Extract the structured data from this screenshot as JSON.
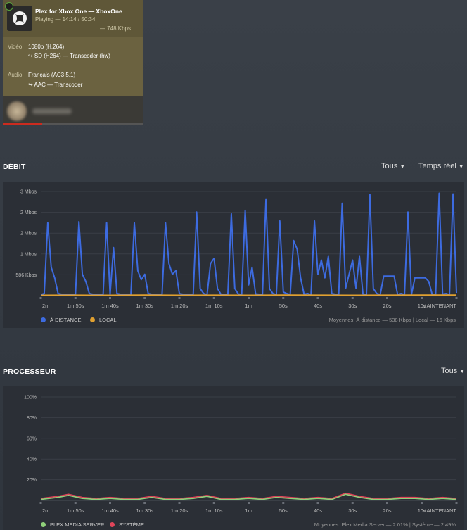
{
  "now_playing": {
    "title": "Plex for Xbox One  —  XboxOne",
    "status": "Playing — 14:14 / 50:34",
    "bitrate": "— 748 Kbps",
    "progress": 0.28,
    "video_label": "Vidéo",
    "video_value": "1080p (H.264)",
    "video_transcode": "↪  SD (H264) — Transcoder (hw)",
    "audio_label": "Audio",
    "audio_value": "Français (AC3 5.1)",
    "audio_transcode": "↪  AAC — Transcoder",
    "icons": {
      "thumb": "xbox-logo-icon",
      "lock": "lock-icon"
    }
  },
  "bandwidth": {
    "title": "DÉBIT",
    "filter_label": "Tous",
    "range_label": "Temps réel",
    "legend_remote": "À DISTANCE",
    "legend_local": "LOCAL",
    "averages": "Moyennes: À distance — 538 Kbps | Local — 16 Kbps",
    "colors": {
      "remote": "#3d6be0",
      "local": "#e0a030"
    }
  },
  "cpu": {
    "title": "PROCESSEUR",
    "filter_label": "Tous",
    "legend_pms": "PLEX MEDIA SERVER",
    "legend_system": "SYSTÈME",
    "averages": "Moyennes: Plex Media Server — 2.01% | Système — 2.49%",
    "colors": {
      "pms": "#8fd07a",
      "system": "#e0455a"
    }
  },
  "chart_data": [
    {
      "type": "line",
      "title": "DÉBIT",
      "y_ticks": [
        "586 Kbps",
        "1 Mbps",
        "2 Mbps",
        "2 Mbps",
        "3 Mbps"
      ],
      "y_tick_values": [
        586,
        1172,
        1758,
        2344,
        2930
      ],
      "ylim": [
        0,
        2930
      ],
      "x_ticks": [
        "2m",
        "1m 50s",
        "1m 40s",
        "1m 30s",
        "1m 20s",
        "1m 10s",
        "1m",
        "50s",
        "40s",
        "30s",
        "20s",
        "10s",
        "MAINTENANT"
      ],
      "x_range_seconds": [
        -120,
        0
      ],
      "series": [
        {
          "name": "À DISTANCE",
          "t": [
            -120,
            -119,
            -118,
            -117,
            -116,
            -115,
            -114,
            -113,
            -112,
            -111,
            -110,
            -109,
            -108,
            -107,
            -106,
            -105,
            -104,
            -103,
            -102,
            -101,
            -100,
            -99,
            -98,
            -97,
            -96,
            -95,
            -94,
            -93,
            -92,
            -91,
            -90,
            -89,
            -88,
            -87,
            -86,
            -85,
            -84,
            -83,
            -82,
            -81,
            -80,
            -79,
            -78,
            -77,
            -76,
            -75,
            -74,
            -73,
            -72,
            -71,
            -70,
            -69,
            -68,
            -67,
            -66,
            -65,
            -64,
            -63,
            -62,
            -61,
            -60,
            -59,
            -58,
            -57,
            -56,
            -55,
            -54,
            -53,
            -52,
            -51,
            -50,
            -49,
            -48,
            -47,
            -46,
            -45,
            -44,
            -43,
            -42,
            -41,
            -40,
            -39,
            -38,
            -37,
            -36,
            -35,
            -34,
            -33,
            -32,
            -31,
            -30,
            -29,
            -28,
            -27,
            -26,
            -25,
            -24,
            -23,
            -22,
            -21,
            -20,
            -19,
            -18,
            -17,
            -16,
            -15,
            -14,
            -13,
            -12,
            -11,
            -10,
            -9,
            -8,
            -7,
            -6,
            -5,
            -4,
            -3,
            -2,
            -1,
            0
          ],
          "values": [
            30,
            60,
            2050,
            800,
            500,
            60,
            40,
            40,
            40,
            40,
            30,
            2080,
            600,
            400,
            60,
            40,
            40,
            40,
            30,
            2050,
            30,
            1350,
            60,
            40,
            40,
            40,
            30,
            2050,
            700,
            450,
            600,
            60,
            40,
            40,
            40,
            30,
            2050,
            900,
            600,
            700,
            60,
            40,
            40,
            40,
            30,
            2350,
            200,
            60,
            30,
            900,
            1050,
            200,
            40,
            40,
            30,
            2300,
            200,
            50,
            30,
            2400,
            300,
            800,
            50,
            40,
            30,
            2700,
            200,
            60,
            30,
            2100,
            100,
            60,
            30,
            1550,
            1300,
            500,
            40,
            60,
            30,
            2100,
            600,
            1000,
            500,
            1100,
            60,
            40,
            30,
            2600,
            200,
            600,
            1000,
            200,
            1100,
            50,
            30,
            2850,
            200,
            60,
            30,
            550,
            550,
            550,
            550,
            30,
            60,
            30,
            2350,
            30,
            500,
            500,
            500,
            500,
            400,
            30,
            30,
            2880,
            40,
            60,
            30,
            2860,
            80,
            1000,
            60,
            1100,
            40,
            1050,
            150,
            520
          ]
        },
        {
          "name": "LOCAL",
          "t": [
            -120,
            -110,
            -100,
            -90,
            -80,
            -70,
            -60,
            -50,
            -40,
            -30,
            -20,
            -10,
            0
          ],
          "values": [
            10,
            12,
            10,
            14,
            10,
            12,
            10,
            14,
            12,
            10,
            12,
            14,
            16
          ]
        }
      ]
    },
    {
      "type": "line",
      "title": "PROCESSEUR",
      "y_ticks": [
        "20%",
        "40%",
        "60%",
        "80%",
        "100%"
      ],
      "y_tick_values": [
        20,
        40,
        60,
        80,
        100
      ],
      "ylim": [
        0,
        100
      ],
      "x_ticks": [
        "2m",
        "1m 50s",
        "1m 40s",
        "1m 30s",
        "1m 20s",
        "1m 10s",
        "1m",
        "50s",
        "40s",
        "30s",
        "20s",
        "10s",
        "MAINTENANT"
      ],
      "x_range_seconds": [
        -120,
        0
      ],
      "series": [
        {
          "name": "PLEX MEDIA SERVER",
          "t": [
            -120,
            -115,
            -112,
            -108,
            -104,
            -100,
            -96,
            -92,
            -88,
            -84,
            -80,
            -76,
            -72,
            -68,
            -64,
            -60,
            -56,
            -52,
            -48,
            -44,
            -40,
            -36,
            -32,
            -28,
            -24,
            -20,
            -16,
            -12,
            -8,
            -4,
            0
          ],
          "values": [
            1,
            3,
            5,
            2,
            1,
            2,
            1,
            1,
            3,
            1,
            1,
            2,
            4,
            1,
            1,
            2,
            1,
            3,
            2,
            1,
            2,
            1,
            6,
            3,
            1,
            1,
            2,
            2,
            1,
            2,
            1
          ]
        },
        {
          "name": "SYSTÈME",
          "t": [
            -120,
            -115,
            -112,
            -108,
            -104,
            -100,
            -96,
            -92,
            -88,
            -84,
            -80,
            -76,
            -72,
            -68,
            -64,
            -60,
            -56,
            -52,
            -48,
            -44,
            -40,
            -36,
            -32,
            -28,
            -24,
            -20,
            -16,
            -12,
            -8,
            -4,
            0
          ],
          "values": [
            2,
            4,
            6,
            3,
            2,
            3,
            2,
            2,
            4,
            2,
            2,
            3,
            5,
            2,
            2,
            3,
            2,
            4,
            3,
            2,
            3,
            2,
            7,
            4,
            2,
            2,
            3,
            3,
            2,
            3,
            2
          ]
        }
      ]
    }
  ]
}
